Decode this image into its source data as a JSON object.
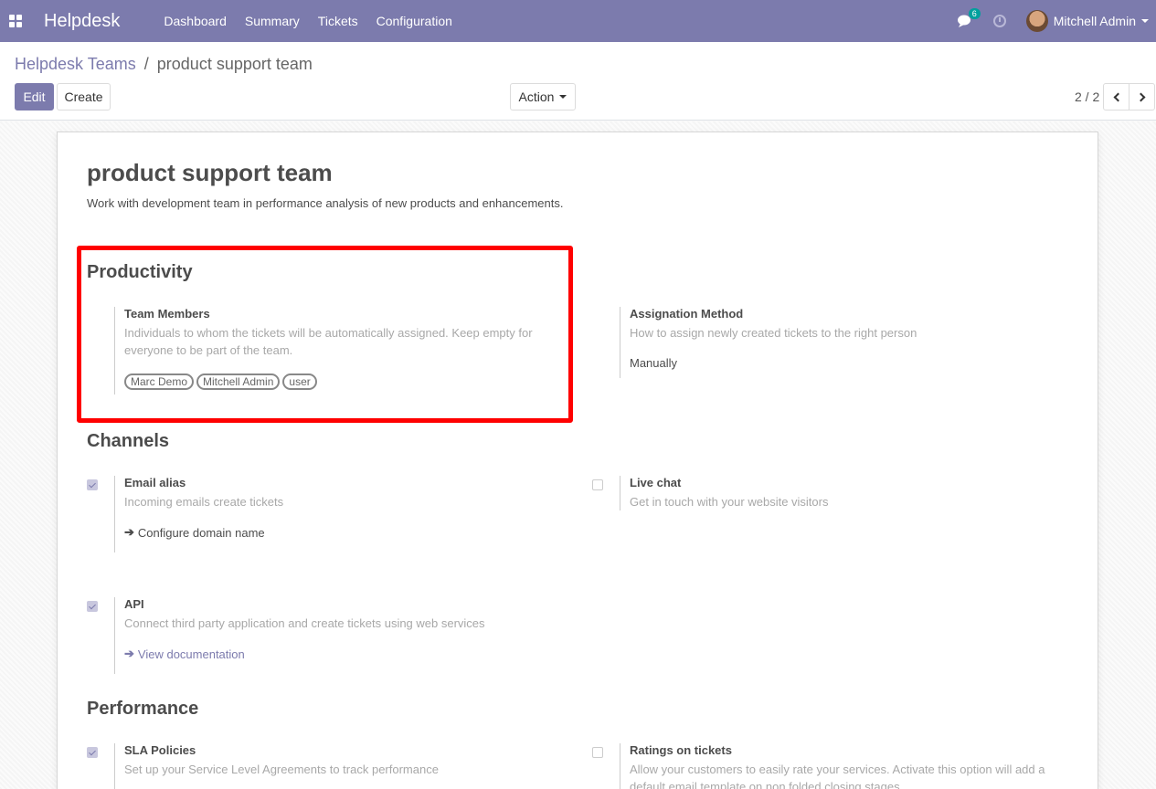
{
  "navbar": {
    "brand": "Helpdesk",
    "menu": [
      "Dashboard",
      "Summary",
      "Tickets",
      "Configuration"
    ],
    "chat_badge": "6",
    "user_name": "Mitchell Admin"
  },
  "breadcrumb": {
    "parent": "Helpdesk Teams",
    "separator": "/",
    "current": "product support team"
  },
  "toolbar": {
    "edit_label": "Edit",
    "create_label": "Create",
    "action_label": "Action",
    "pager": "2 / 2"
  },
  "record": {
    "title": "product support team",
    "description": "Work with development team in performance analysis of new products and enhancements."
  },
  "sections": {
    "productivity": {
      "heading": "Productivity",
      "team_members": {
        "title": "Team Members",
        "help": "Individuals to whom the tickets will be automatically assigned. Keep empty for everyone to be part of the team.",
        "tags": [
          "Marc Demo",
          "Mitchell Admin",
          "user"
        ]
      },
      "assignation": {
        "title": "Assignation Method",
        "help": "How to assign newly created tickets to the right person",
        "value": "Manually"
      }
    },
    "channels": {
      "heading": "Channels",
      "email_alias": {
        "title": "Email alias",
        "help": "Incoming emails create tickets",
        "link": "Configure domain name",
        "checked": true
      },
      "live_chat": {
        "title": "Live chat",
        "help": "Get in touch with your website visitors",
        "checked": false
      },
      "api": {
        "title": "API",
        "help": "Connect third party application and create tickets using web services",
        "link": "View documentation",
        "checked": true
      }
    },
    "performance": {
      "heading": "Performance",
      "sla": {
        "title": "SLA Policies",
        "help": "Set up your Service Level Agreements to track performance",
        "checked": true
      },
      "ratings": {
        "title": "Ratings on tickets",
        "help": "Allow your customers to easily rate your services. Activate this option will add a default email template on non folded closing stages",
        "checked": false
      }
    }
  },
  "colors": {
    "brand": "#7c7bad",
    "highlight": "#ff0000",
    "badge": "#00a09d"
  }
}
